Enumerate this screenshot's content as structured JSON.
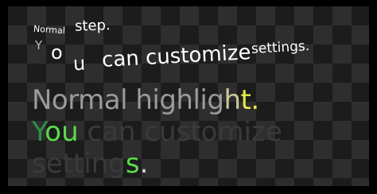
{
  "line1": {
    "small": "Normal",
    "big": "step."
  },
  "line2": {
    "y": "Y",
    "o": "o",
    "u": "u",
    "mid": "can customize",
    "end": "settings."
  },
  "highlight": {
    "line1": {
      "a": "Normal highlig",
      "b": "h",
      "c": "t",
      "d": "."
    },
    "line2": {
      "y": "Y",
      "ou": "ou",
      "rest": " can customize"
    },
    "line3": {
      "a": "setting",
      "s": "s",
      "dot": "."
    }
  }
}
